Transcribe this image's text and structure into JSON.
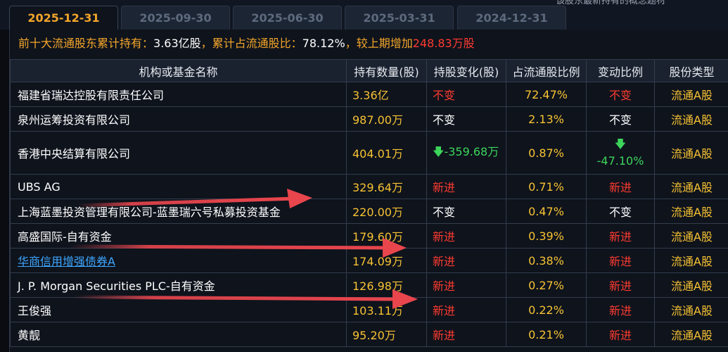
{
  "tabs": [
    "2025-12-31",
    "2025-09-30",
    "2025-06-30",
    "2025-03-31",
    "2024-12-31"
  ],
  "top_note": "该股东最新持有的概念题材",
  "summary": {
    "label1": "前十大流通股东累计持有：",
    "value1": "3.63亿股",
    "label2": "，累计占流通股比：",
    "value2": "78.12%",
    "label3": "，较上期增加",
    "value3": "248.83万股"
  },
  "columns": [
    "机构或基金名称",
    "持有数量(股)",
    "持股变化(股)",
    "占流通股比例",
    "变动比例",
    "股份类型"
  ],
  "rows": [
    {
      "name": "福建省瑞达控股有限责任公司",
      "qty": "3.36亿",
      "change": "不变",
      "ratio": "72.47%",
      "var": "不变",
      "type": "流通A股"
    },
    {
      "name": "泉州运筹投资有限公司",
      "qty": "987.00万",
      "change": "不变",
      "ratio": "2.13%",
      "var": "不变",
      "type": "流通A股"
    },
    {
      "name": "香港中央结算有限公司",
      "qty": "404.01万",
      "change": "-359.68万",
      "ratio": "0.87%",
      "var": "-47.10%",
      "type": "流通A股"
    },
    {
      "name": "UBS AG",
      "qty": "329.64万",
      "change": "新进",
      "ratio": "0.71%",
      "var": "新进",
      "type": "流通A股"
    },
    {
      "name": "上海蓝墨投资管理有限公司-蓝墨瑞六号私募投资基金",
      "qty": "220.00万",
      "change": "不变",
      "ratio": "0.47%",
      "var": "不变",
      "type": "流通A股"
    },
    {
      "name": "高盛国际-自有资金",
      "qty": "179.60万",
      "change": "新进",
      "ratio": "0.39%",
      "var": "新进",
      "type": "流通A股"
    },
    {
      "name": "华商信用增强债券A",
      "qty": "174.09万",
      "change": "新进",
      "ratio": "0.38%",
      "var": "新进",
      "type": "流通A股"
    },
    {
      "name": "J. P. Morgan Securities PLC-自有资金",
      "qty": "126.98万",
      "change": "新进",
      "ratio": "0.27%",
      "var": "新进",
      "type": "流通A股"
    },
    {
      "name": "王俊强",
      "qty": "103.11万",
      "change": "新进",
      "ratio": "0.22%",
      "var": "新进",
      "type": "流通A股"
    },
    {
      "name": "黄靓",
      "qty": "95.20万",
      "change": "新进",
      "ratio": "0.21%",
      "var": "新进",
      "type": "流通A股"
    }
  ],
  "colors": {
    "accent": "#f4a62a",
    "increase": "#ff3b30",
    "decrease": "#3cd45a",
    "link": "#3fa7ff",
    "annotation_arrow": "#e8454d"
  }
}
